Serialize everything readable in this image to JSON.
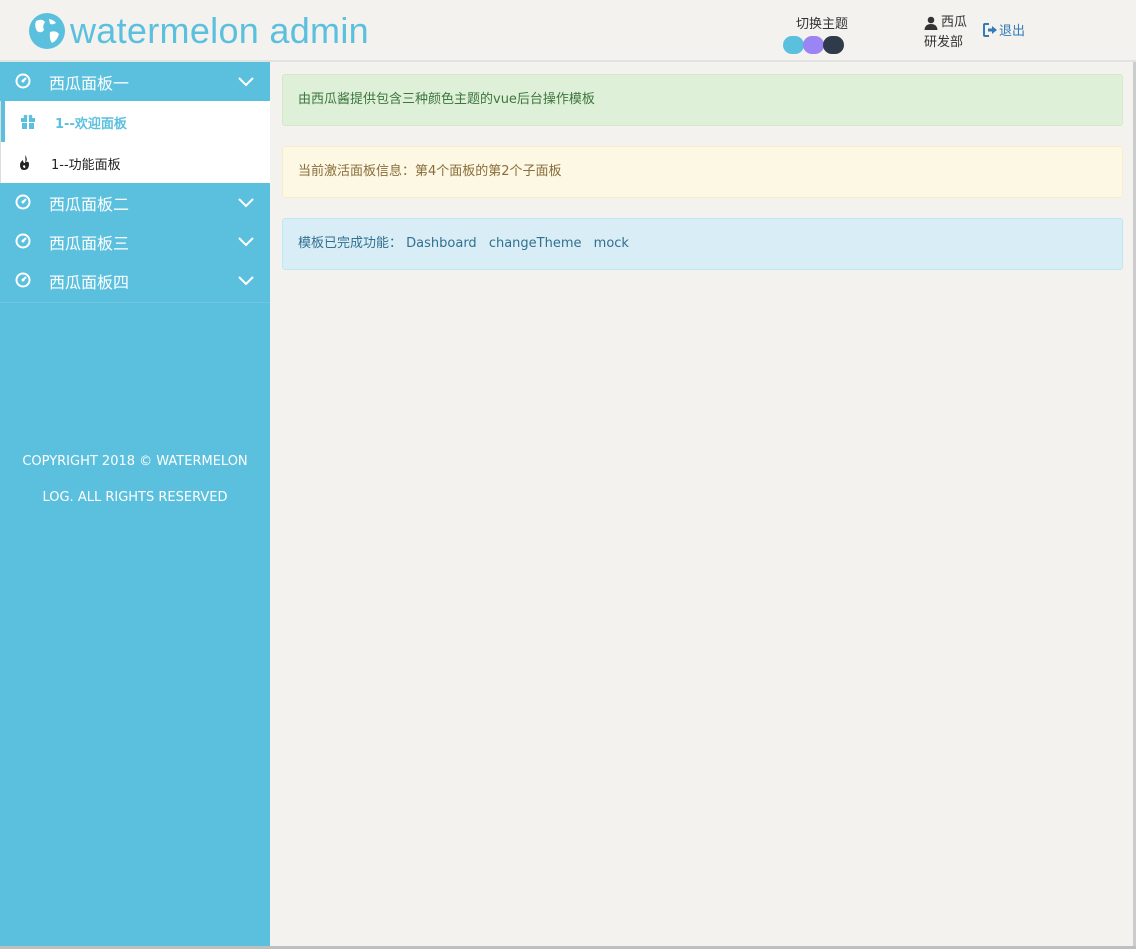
{
  "header": {
    "app_title": "watermelon admin",
    "theme_label": "切换主题",
    "themes": [
      {
        "name": "blue",
        "color": "#5bc0de"
      },
      {
        "name": "purple",
        "color": "#9b85f4"
      },
      {
        "name": "dark",
        "color": "#2f3a4a"
      }
    ],
    "user_name": "西瓜",
    "department": "研发部",
    "logout_label": "退出"
  },
  "sidebar": {
    "groups": [
      {
        "label": "西瓜面板一",
        "icon": "dashboard-icon",
        "expanded": true,
        "items": [
          {
            "label": "1--欢迎面板",
            "icon": "gift-icon",
            "active": true
          },
          {
            "label": "1--功能面板",
            "icon": "fire-icon",
            "active": false
          }
        ]
      },
      {
        "label": "西瓜面板二",
        "icon": "dashboard-icon",
        "expanded": false
      },
      {
        "label": "西瓜面板三",
        "icon": "dashboard-icon",
        "expanded": false
      },
      {
        "label": "西瓜面板四",
        "icon": "dashboard-icon",
        "expanded": false
      }
    ],
    "copyright_line1": "COPYRIGHT 2018 © WATERMELON",
    "copyright_line2": "LOG. ALL RIGHTS RESERVED"
  },
  "main": {
    "intro": "由西瓜酱提供包含三种颜色主题的vue后台操作模板",
    "active_panel_info": "当前激活面板信息：第4个面板的第2个子面板",
    "features_label": "模板已完成功能：",
    "features": [
      "Dashboard",
      "changeTheme",
      "mock"
    ]
  },
  "colors": {
    "accent": "#5bc0de",
    "link": "#337ab7",
    "background": "#f3f2ef"
  }
}
